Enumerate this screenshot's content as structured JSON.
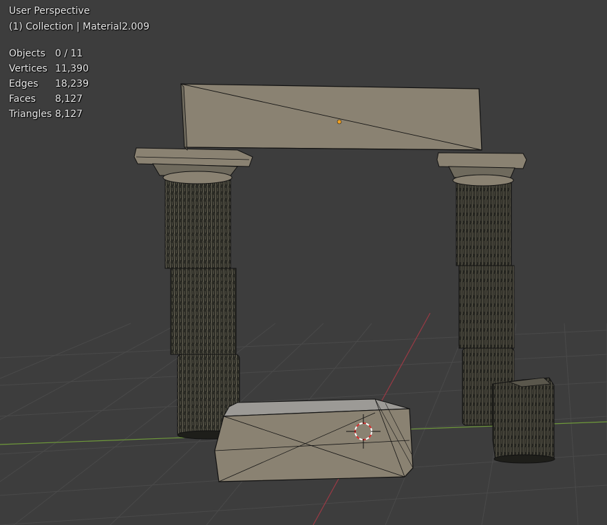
{
  "viewport": {
    "view_name": "User Perspective",
    "collection_label": "(1) Collection | Material2.009"
  },
  "stats": [
    {
      "label": "Objects",
      "value": "0 / 11"
    },
    {
      "label": "Vertices",
      "value": "11,390"
    },
    {
      "label": "Edges",
      "value": "18,239"
    },
    {
      "label": "Faces",
      "value": "8,127"
    },
    {
      "label": "Triangles",
      "value": "8,127"
    }
  ],
  "colors": {
    "background": "#3d3d3d",
    "grid_line": "#4a4a4a",
    "x_axis": "#9b3a45",
    "y_axis": "#6f9a3a",
    "stone": "#8a8272",
    "wireframe": "#111111",
    "origin_point": "#f0a020",
    "cursor_red": "#d83030"
  },
  "scene_objects": [
    "lintel-beam",
    "column-left",
    "column-right",
    "column-broken",
    "stone-block",
    "capital-left",
    "capital-right"
  ]
}
